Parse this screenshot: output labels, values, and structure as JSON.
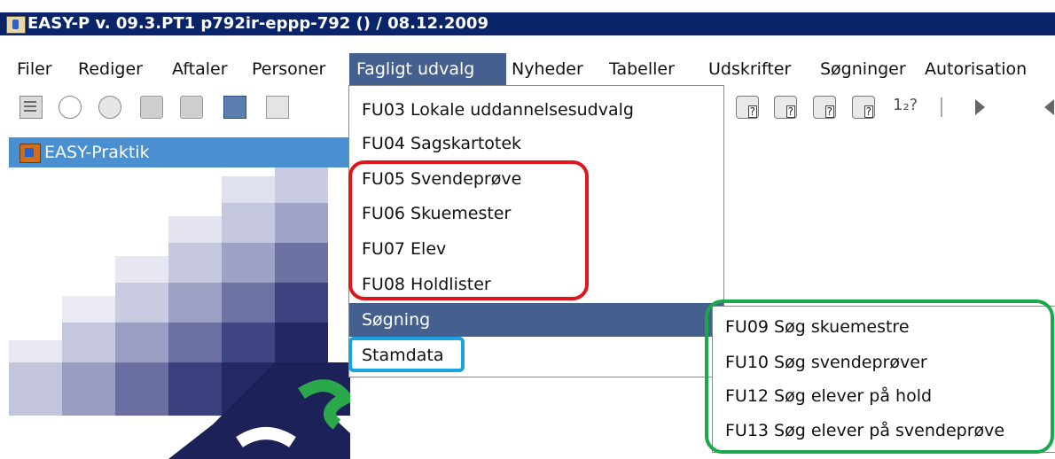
{
  "window": {
    "title": "EASY-P v. 09.3.PT1 p792ir-eppp-792 () / 08.12.2009",
    "icon": "java-cup-icon"
  },
  "menubar": {
    "items": [
      {
        "label": "Filer"
      },
      {
        "label": "Rediger"
      },
      {
        "label": "Aftaler"
      },
      {
        "label": "Personer"
      },
      {
        "label": "Fagligt udvalg"
      },
      {
        "label": "Nyheder"
      },
      {
        "label": "Tabeller"
      },
      {
        "label": "Udskrifter"
      },
      {
        "label": "Søgninger"
      },
      {
        "label": "Autorisation"
      }
    ]
  },
  "toolbar": {
    "icons": [
      "list-icon",
      "eraser-icon",
      "note-icon",
      "disk-icon",
      "disk-search-icon",
      "copy-windows-icon",
      "blank-page-icon",
      "db-query-icon",
      "db-query-edit-icon",
      "db-query-delete-icon",
      "db-query-run-icon",
      "sort-icon",
      "separator",
      "play-icon",
      "back-icon"
    ],
    "sort_label": "1₂?"
  },
  "panel": {
    "title": "EASY-Praktik"
  },
  "dropdown": {
    "items": [
      {
        "label": "FU03 Lokale uddannelsesudvalg"
      },
      {
        "label": "FU04 Sagskartotek"
      },
      {
        "label": "FU05 Svendeprøve"
      },
      {
        "label": "FU06 Skuemester"
      },
      {
        "label": "FU07 Elev"
      },
      {
        "label": "FU08 Holdlister"
      },
      {
        "label": "Søgning"
      },
      {
        "label": "Stamdata"
      }
    ]
  },
  "submenu": {
    "items": [
      {
        "label": "FU09 Søg skuemestre"
      },
      {
        "label": "FU10 Søg svendeprøver"
      },
      {
        "label": "FU12 Søg elever på hold"
      },
      {
        "label": "FU13 Søg elever på svendeprøve"
      }
    ]
  },
  "colors": {
    "titlebar": "#0a246a",
    "menu_highlight": "#45608e",
    "panel_title": "#4a8fd0",
    "highlight_red": "#e0161b",
    "highlight_blue": "#1aa3e0",
    "highlight_green": "#19a84a"
  }
}
